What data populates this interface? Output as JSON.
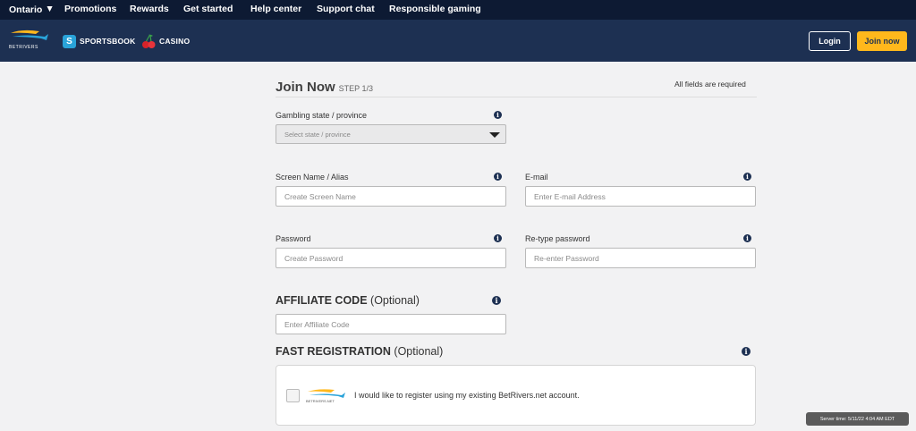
{
  "topnav": {
    "region": "Ontario",
    "links": [
      "Promotions",
      "Rewards",
      "Get started",
      "Help center",
      "Support chat",
      "Responsible gaming"
    ]
  },
  "header": {
    "logo_text": "BETRIVERS",
    "sportsbook_label": "SPORTSBOOK",
    "casino_label": "CASINO",
    "login_label": "Login",
    "join_label": "Join now"
  },
  "form": {
    "title": "Join Now",
    "step": "STEP 1/3",
    "required_note": "All fields are required",
    "state": {
      "label": "Gambling state / province",
      "placeholder": "Select state / province"
    },
    "screen_name": {
      "label": "Screen Name / Alias",
      "placeholder": "Create Screen Name"
    },
    "email": {
      "label": "E-mail",
      "placeholder": "Enter E-mail Address"
    },
    "password": {
      "label": "Password",
      "placeholder": "Create Password"
    },
    "retype_password": {
      "label": "Re-type password",
      "placeholder": "Re-enter Password"
    },
    "affiliate": {
      "heading": "AFFILIATE CODE",
      "optional": "(Optional)",
      "placeholder": "Enter Affiliate Code"
    },
    "fast_registration": {
      "heading": "FAST REGISTRATION",
      "optional": "(Optional)",
      "logo_text": "BETRIVERS.NET",
      "checkbox_label": "I would like to register using my existing BetRivers.net account."
    }
  },
  "server_time": "Server time: 5/11/22 4:04 AM EDT",
  "colors": {
    "nav_dark": "#0d1a33",
    "header": "#1d3052",
    "accent": "#ffb81c",
    "sportsbook_blue": "#29a3d9"
  },
  "icons": [
    "chevron-down-icon",
    "betrivers-logo",
    "sportsbook-icon",
    "cherries-icon",
    "info-icon",
    "caret-down-icon"
  ]
}
